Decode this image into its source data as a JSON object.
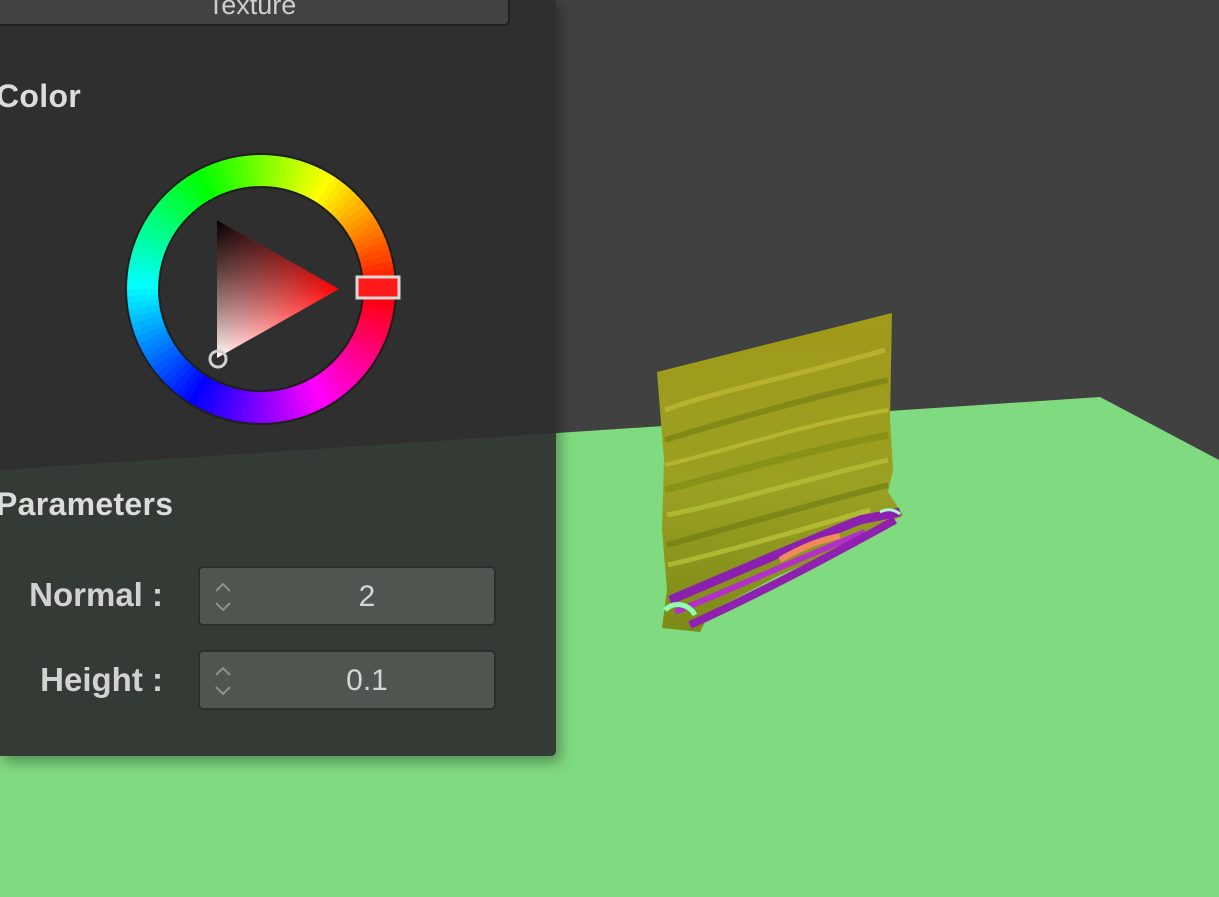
{
  "sidebar": {
    "texture_button_label": "Texture",
    "color_section_title": "Color",
    "color_picker": {
      "hue_degrees": 0,
      "selected_color": "#ff1a1a"
    },
    "parameters_section_title": "Parameters",
    "parameters": [
      {
        "label": "Normal :",
        "value": "2"
      },
      {
        "label": "Height :",
        "value": "0.1"
      }
    ]
  },
  "scene": {
    "background_color": "#414141",
    "ground_color": "#80da80",
    "object": "textured-plane"
  }
}
